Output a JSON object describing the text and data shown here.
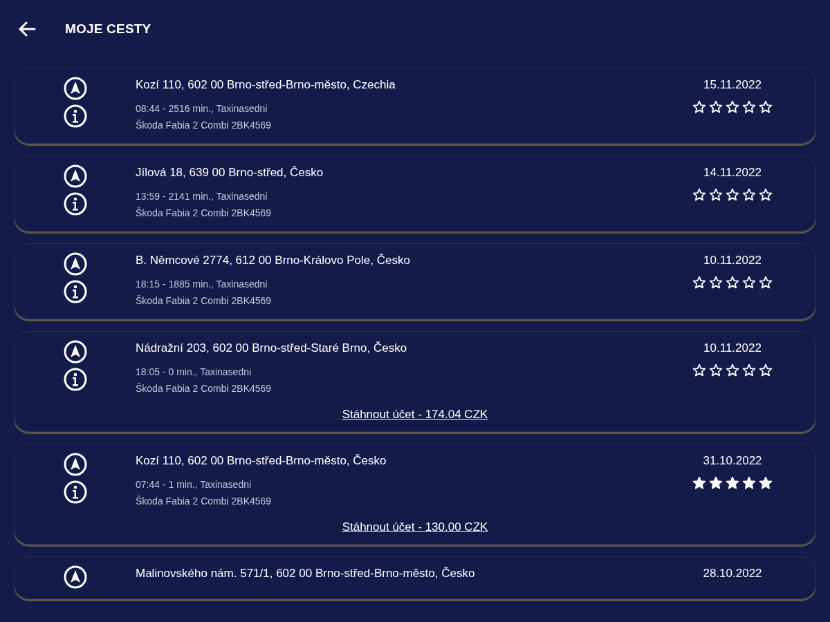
{
  "header": {
    "title": "MOJE CESTY"
  },
  "trips": [
    {
      "address": "Kozí 110, 602 00 Brno-střed-Brno-město, Czechia",
      "meta": "08:44 - 2516 min., Taxinasedni",
      "car": "Škoda Fabia 2 Combi 2BK4569",
      "date": "15.11.2022",
      "stars": 0
    },
    {
      "address": "Jílová 18, 639 00 Brno-střed, Česko",
      "meta": "13:59 - 2141 min., Taxinasedni",
      "car": "Škoda Fabia 2 Combi 2BK4569",
      "date": "14.11.2022",
      "stars": 0
    },
    {
      "address": "B. Němcové 2774, 612 00 Brno-Královo Pole, Česko",
      "meta": "18:15 - 1885 min., Taxinasedni",
      "car": "Škoda Fabia 2 Combi 2BK4569",
      "date": "10.11.2022",
      "stars": 0
    },
    {
      "address": "Nádražní 203, 602 00 Brno-střed-Staré Brno, Česko",
      "meta": "18:05 - 0 min., Taxinasedni",
      "car": "Škoda Fabia 2 Combi 2BK4569",
      "date": "10.11.2022",
      "stars": 0,
      "receipt": "Stáhnout účet - 174.04 CZK"
    },
    {
      "address": "Kozí 110, 602 00 Brno-střed-Brno-město, Česko",
      "meta": "07:44 - 1 min., Taxinasedni",
      "car": "Škoda Fabia 2 Combi 2BK4569",
      "date": "31.10.2022",
      "stars": 5,
      "receipt": "Stáhnout účet - 130.00 CZK"
    },
    {
      "address": "Malinovského nám. 571/1, 602 00 Brno-střed-Brno-město, Česko",
      "date": "28.10.2022"
    }
  ]
}
